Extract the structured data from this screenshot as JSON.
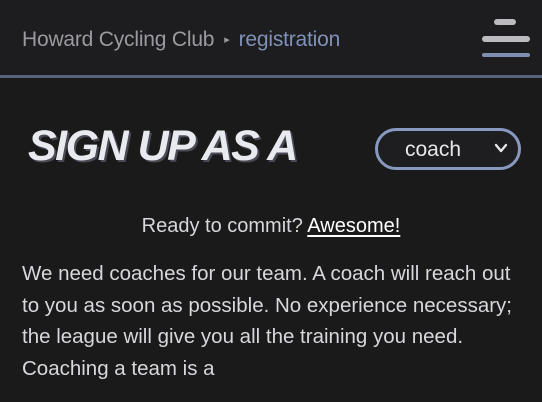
{
  "header": {
    "site_name": "Howard Cycling Club",
    "separator": "▸",
    "current_page": "registration",
    "menu_icon": "hamburger-menu-icon"
  },
  "main": {
    "title": "SIGN UP AS A",
    "role_select": {
      "selected": "coach",
      "icon": "chevron-down-icon"
    },
    "lede_prefix": "Ready to commit? ",
    "lede_link": "Awesome!",
    "body": "We need coaches for our team. A coach will reach out to you as soon as possible. No experience necessary; the league will give you all the training you need. Coaching a team is a"
  },
  "colors": {
    "background": "#1a1a1a",
    "accent": "#8899c0",
    "text": "#d7d7dc",
    "title": "#e9e9f0"
  }
}
